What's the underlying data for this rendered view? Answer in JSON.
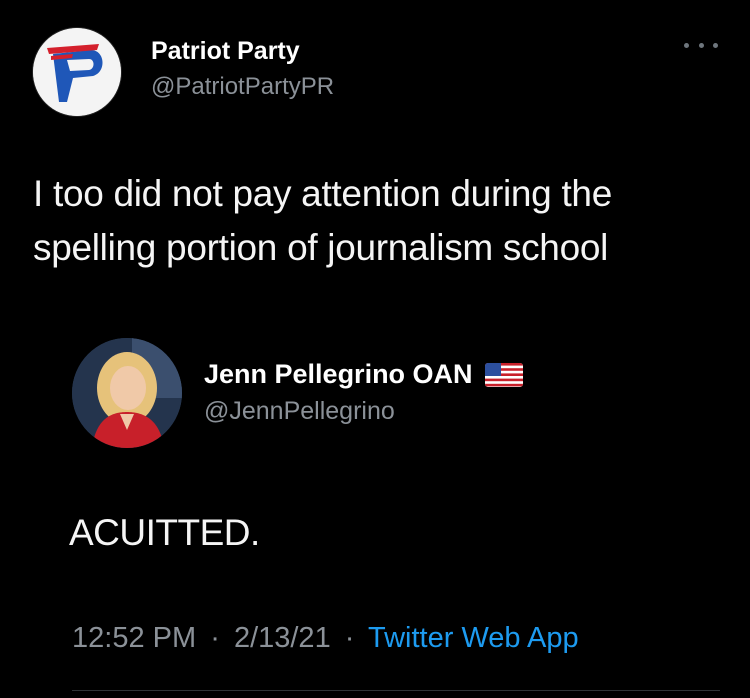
{
  "tweet": {
    "author": {
      "name": "Patriot Party",
      "handle": "@PatriotPartyPR",
      "avatar_icon": "patriot-party-logo"
    },
    "more_icon": "more-dots-icon",
    "text": "I too did not pay attention during the spelling portion of journalism school",
    "quoted": {
      "name": "Jenn Pellegrino OAN",
      "flag_icon": "us-flag-icon",
      "handle": "@JennPellegrino",
      "avatar_icon": "profile-photo",
      "text": "ACUITTED."
    },
    "meta": {
      "time": "12:52 PM",
      "separator": "·",
      "date": "2/13/21",
      "source": "Twitter Web App"
    }
  },
  "colors": {
    "background": "#000000",
    "text": "#f5f5f5",
    "muted": "#8b9198",
    "link": "#1d9bf0",
    "brand_red": "#d4202c",
    "brand_blue": "#1f57b8"
  }
}
